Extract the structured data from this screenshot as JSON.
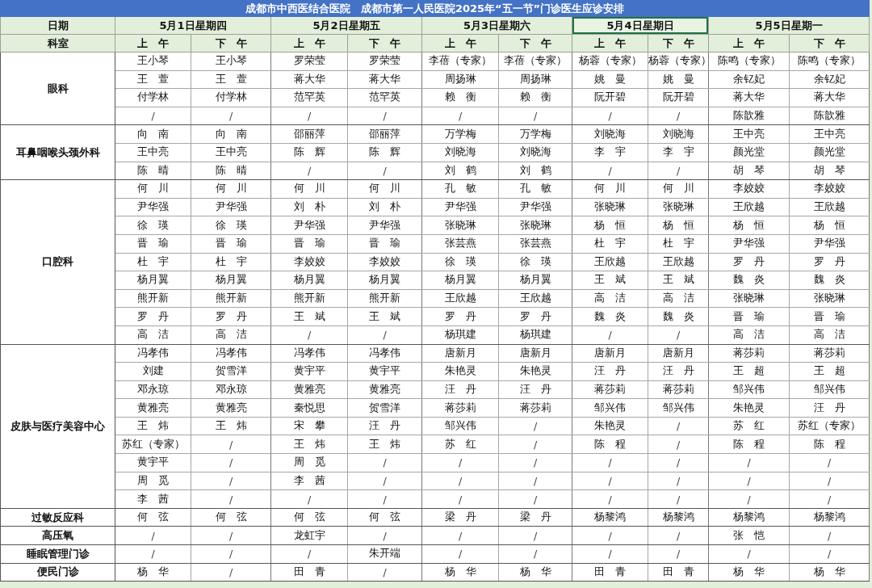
{
  "title": "成都市中西医结合医院　成都市第一人民医院2025年“五一节”门诊医生应诊安排",
  "date_label": "日期",
  "dept_label": "科室",
  "days": [
    {
      "label": "5月1日星期四",
      "selected": false
    },
    {
      "label": "5月2日星期五",
      "selected": false
    },
    {
      "label": "5月3日星期六",
      "selected": false
    },
    {
      "label": "5月4日星期日",
      "selected": true
    },
    {
      "label": "5月5日星期一",
      "selected": false
    }
  ],
  "sessions": [
    "上　午",
    "下　午",
    "上　午",
    "下　午",
    "上　午",
    "下　午",
    "上　午",
    "下　午",
    "上　午",
    "下　午"
  ],
  "departments": [
    {
      "name": "眼科",
      "rows": [
        [
          "王小琴",
          "王小琴",
          "罗荣莹",
          "罗荣莹",
          "李蓓（专家）",
          "李蓓（专家）",
          "杨蓉（专家）",
          "杨蓉（专家）",
          "陈鸣（专家）",
          "陈鸣（专家）"
        ],
        [
          "王　萱",
          "王　萱",
          "蒋大华",
          "蒋大华",
          "周扬琳",
          "周扬琳",
          "姚　曼",
          "姚　曼",
          "余钇妃",
          "余钇妃"
        ],
        [
          "付学林",
          "付学林",
          "范罕英",
          "范罕英",
          "赖　衡",
          "赖　衡",
          "阮开碧",
          "阮开碧",
          "蒋大华",
          "蒋大华"
        ],
        [
          "/",
          "/",
          "/",
          "/",
          "/",
          "/",
          "/",
          "/",
          "陈歆雅",
          "陈歆雅"
        ]
      ]
    },
    {
      "name": "耳鼻咽喉头颈外科",
      "rows": [
        [
          "向　南",
          "向　南",
          "邵丽萍",
          "邵丽萍",
          "万学梅",
          "万学梅",
          "刘晓海",
          "刘晓海",
          "王中亮",
          "王中亮"
        ],
        [
          "王中亮",
          "王中亮",
          "陈　辉",
          "陈　辉",
          "刘晓海",
          "刘晓海",
          "李　宇",
          "李　宇",
          "颜光堂",
          "颜光堂"
        ],
        [
          "陈　晴",
          "陈　晴",
          "/",
          "/",
          "刘　鹤",
          "刘　鹤",
          "/",
          "/",
          "胡　琴",
          "胡　琴"
        ]
      ]
    },
    {
      "name": "口腔科",
      "rows": [
        [
          "何　川",
          "何　川",
          "何　川",
          "何　川",
          "孔　敏",
          "孔　敏",
          "何　川",
          "何　川",
          "李姣姣",
          "李姣姣"
        ],
        [
          "尹华强",
          "尹华强",
          "刘　朴",
          "刘　朴",
          "尹华强",
          "尹华强",
          "张晓琳",
          "张晓琳",
          "王欣越",
          "王欣越"
        ],
        [
          "徐　瑛",
          "徐　瑛",
          "尹华强",
          "尹华强",
          "张晓琳",
          "张晓琳",
          "杨　恒",
          "杨　恒",
          "杨　恒",
          "杨　恒"
        ],
        [
          "晋　瑜",
          "晋　瑜",
          "晋　瑜",
          "晋　瑜",
          "张芸燕",
          "张芸燕",
          "杜　宇",
          "杜　宇",
          "尹华强",
          "尹华强"
        ],
        [
          "杜　宇",
          "杜　宇",
          "李姣姣",
          "李姣姣",
          "徐　瑛",
          "徐　瑛",
          "王欣越",
          "王欣越",
          "罗　丹",
          "罗　丹"
        ],
        [
          "杨月翼",
          "杨月翼",
          "杨月翼",
          "杨月翼",
          "杨月翼",
          "杨月翼",
          "王　斌",
          "王　斌",
          "魏　炎",
          "魏　炎"
        ],
        [
          "熊开新",
          "熊开新",
          "熊开新",
          "熊开新",
          "王欣越",
          "王欣越",
          "高　洁",
          "高　洁",
          "张晓琳",
          "张晓琳"
        ],
        [
          "罗　丹",
          "罗　丹",
          "王　斌",
          "王　斌",
          "罗　丹",
          "罗　丹",
          "魏　炎",
          "魏　炎",
          "晋　瑜",
          "晋　瑜"
        ],
        [
          "高　洁",
          "高　洁",
          "/",
          "/",
          "杨琪建",
          "杨琪建",
          "/",
          "/",
          "高　洁",
          "高　洁"
        ]
      ]
    },
    {
      "name": "皮肤与医疗美容中心",
      "rows": [
        [
          "冯孝伟",
          "冯孝伟",
          "冯孝伟",
          "冯孝伟",
          "唐新月",
          "唐新月",
          "唐新月",
          "唐新月",
          "蒋莎莉",
          "蒋莎莉"
        ],
        [
          "刘建",
          "贺雪洋",
          "黄宇平",
          "黄宇平",
          "朱艳灵",
          "朱艳灵",
          "汪　丹",
          "汪　丹",
          "王　超",
          "王　超"
        ],
        [
          "邓永琼",
          "邓永琼",
          "黄雅亮",
          "黄雅亮",
          "汪　丹",
          "汪　丹",
          "蒋莎莉",
          "蒋莎莉",
          "邹兴伟",
          "邹兴伟"
        ],
        [
          "黄雅亮",
          "黄雅亮",
          "秦悦思",
          "贺雪洋",
          "蒋莎莉",
          "蒋莎莉",
          "邹兴伟",
          "邹兴伟",
          "朱艳灵",
          "汪　丹"
        ],
        [
          "王　炜",
          "王　炜",
          "宋　攀",
          "汪　丹",
          "邹兴伟",
          "/",
          "朱艳灵",
          "/",
          "苏　红",
          "苏红（专家）"
        ],
        [
          "苏红（专家）",
          "/",
          "王　炜",
          "王　炜",
          "苏　红",
          "/",
          "陈　程",
          "/",
          "陈　程",
          "陈　程"
        ],
        [
          "黄宇平",
          "/",
          "周　觅",
          "/",
          "/",
          "/",
          "/",
          "/",
          "/",
          "/"
        ],
        [
          "周　觅",
          "/",
          "李　茜",
          "/",
          "/",
          "/",
          "/",
          "/",
          "/",
          "/"
        ],
        [
          "李　茜",
          "/",
          "/",
          "/",
          "/",
          "/",
          "/",
          "/",
          "/",
          "/"
        ]
      ]
    },
    {
      "name": "过敏反应科",
      "rows": [
        [
          "何　弦",
          "何　弦",
          "何　弦",
          "何　弦",
          "梁　丹",
          "梁　丹",
          "杨黎鸿",
          "杨黎鸿",
          "杨黎鸿",
          "杨黎鸿"
        ]
      ]
    },
    {
      "name": "高压氧",
      "rows": [
        [
          "/",
          "/",
          "龙虹宇",
          "/",
          "/",
          "/",
          "/",
          "/",
          "张　恺",
          "/"
        ]
      ]
    },
    {
      "name": "睡眠管理门诊",
      "rows": [
        [
          "/",
          "/",
          "/",
          "朱开端",
          "/",
          "/",
          "/",
          "/",
          "/",
          "/"
        ]
      ]
    },
    {
      "name": "便民门诊",
      "rows": [
        [
          "杨　华",
          "/",
          "田　青",
          "/",
          "杨　华",
          "杨　华",
          "田　青",
          "田　青",
          "杨　华",
          "杨　华"
        ]
      ]
    }
  ]
}
